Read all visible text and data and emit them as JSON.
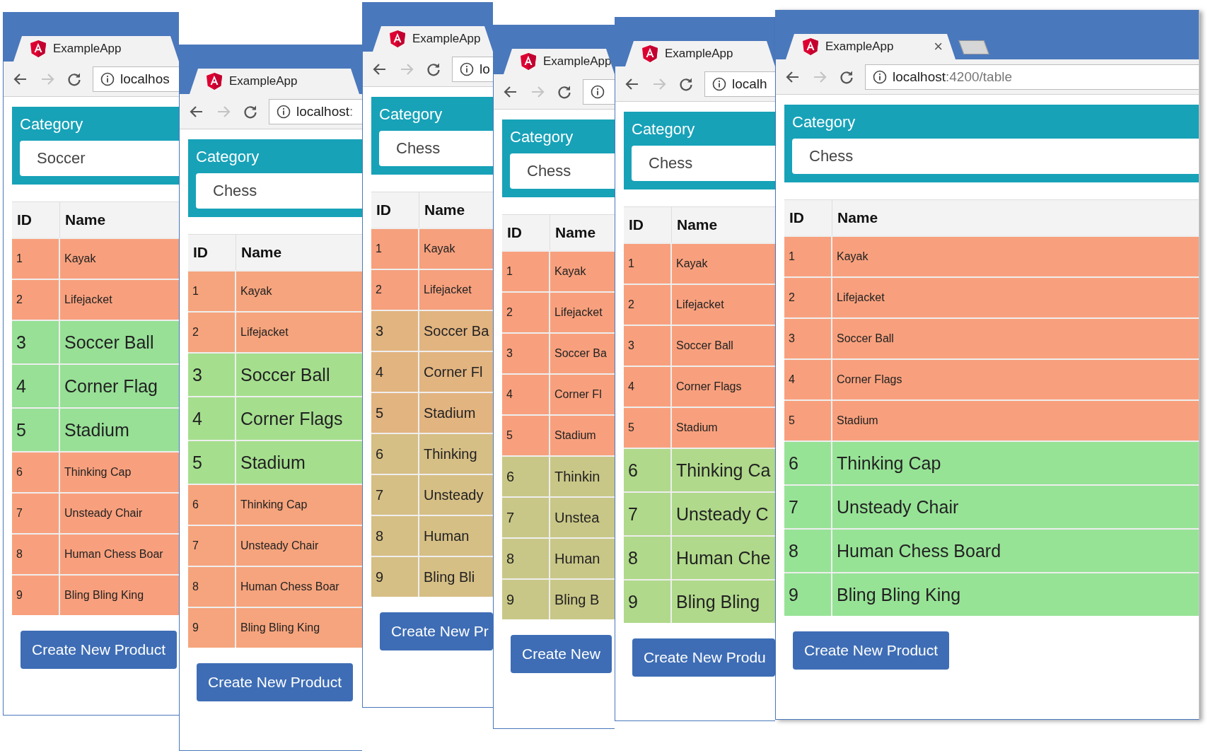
{
  "windows": [
    {
      "tab": {
        "title": "ExampleApp"
      },
      "address": {
        "host": "localhos"
      },
      "category": {
        "label": "Category",
        "value": "Soccer"
      },
      "columns": [
        "ID",
        "Name"
      ],
      "rows": [
        {
          "id": "1",
          "name": "Kayak",
          "kind": "small",
          "color": "#f8a07d"
        },
        {
          "id": "2",
          "name": "Lifejacket",
          "kind": "small",
          "color": "#f8a07d"
        },
        {
          "id": "3",
          "name": "Soccer Ball",
          "kind": "large",
          "color": "#97e096"
        },
        {
          "id": "4",
          "name": "Corner Flag",
          "kind": "large",
          "color": "#97e096"
        },
        {
          "id": "5",
          "name": "Stadium",
          "kind": "large",
          "color": "#97e096"
        },
        {
          "id": "6",
          "name": "Thinking Cap",
          "kind": "small",
          "color": "#f8a07d"
        },
        {
          "id": "7",
          "name": "Unsteady Chair",
          "kind": "small",
          "color": "#f8a07d"
        },
        {
          "id": "8",
          "name": "Human Chess Boar",
          "kind": "small",
          "color": "#f8a07d"
        },
        {
          "id": "9",
          "name": "Bling Bling King",
          "kind": "small",
          "color": "#f8a07d"
        }
      ],
      "button": "Create New Product"
    },
    {
      "tab": {
        "title": "ExampleApp"
      },
      "address": {
        "host": "localhost",
        "path": ":"
      },
      "category": {
        "label": "Category",
        "value": "Chess"
      },
      "columns": [
        "ID",
        "Name"
      ],
      "rows": [
        {
          "id": "1",
          "name": "Kayak",
          "kind": "small",
          "color": "#f6a47d"
        },
        {
          "id": "2",
          "name": "Lifejacket",
          "kind": "small",
          "color": "#f6a47d"
        },
        {
          "id": "3",
          "name": "Soccer Ball",
          "kind": "large",
          "color": "#a5df8e"
        },
        {
          "id": "4",
          "name": "Corner Flags",
          "kind": "large",
          "color": "#a5df8e"
        },
        {
          "id": "5",
          "name": "Stadium",
          "kind": "large",
          "color": "#a5df8e"
        },
        {
          "id": "6",
          "name": "Thinking Cap",
          "kind": "small",
          "color": "#f6a47d"
        },
        {
          "id": "7",
          "name": "Unsteady Chair",
          "kind": "small",
          "color": "#f6a47d"
        },
        {
          "id": "8",
          "name": "Human Chess Boar",
          "kind": "small",
          "color": "#f6a47d"
        },
        {
          "id": "9",
          "name": "Bling Bling King",
          "kind": "small",
          "color": "#f6a47d"
        }
      ],
      "button": "Create New Product"
    },
    {
      "tab": {
        "title": "ExampleApp"
      },
      "address": {
        "host": "lo"
      },
      "category": {
        "label": "Category",
        "value": "Chess"
      },
      "columns": [
        "ID",
        "Name"
      ],
      "rows": [
        {
          "id": "1",
          "name": "Kayak",
          "kind": "small",
          "color": "#f6a07d"
        },
        {
          "id": "2",
          "name": "Lifejacket",
          "kind": "small",
          "color": "#f6a07d"
        },
        {
          "id": "3",
          "name": "Soccer Ba",
          "kind": "medium",
          "color": "#e2b480"
        },
        {
          "id": "4",
          "name": "Corner Fl",
          "kind": "medium",
          "color": "#e2b480"
        },
        {
          "id": "5",
          "name": "Stadium",
          "kind": "medium",
          "color": "#e2b480"
        },
        {
          "id": "6",
          "name": "Thinking",
          "kind": "medium",
          "color": "#d6bf85"
        },
        {
          "id": "7",
          "name": "Unsteady",
          "kind": "medium",
          "color": "#d6bf85"
        },
        {
          "id": "8",
          "name": "Human",
          "kind": "medium",
          "color": "#d6bf85"
        },
        {
          "id": "9",
          "name": "Bling Bli",
          "kind": "medium",
          "color": "#d6bf85"
        }
      ],
      "button": "Create New Pr"
    },
    {
      "tab": {
        "title": "ExampleApp"
      },
      "category": {
        "label": "Category",
        "value": "Chess"
      },
      "columns": [
        "ID",
        "Name"
      ],
      "rows": [
        {
          "id": "1",
          "name": "Kayak",
          "kind": "small",
          "color": "#f8a07d"
        },
        {
          "id": "2",
          "name": "Lifejacket",
          "kind": "small",
          "color": "#f8a07d"
        },
        {
          "id": "3",
          "name": "Soccer Ba",
          "kind": "small",
          "color": "#f8a07d"
        },
        {
          "id": "4",
          "name": "Corner Fl",
          "kind": "small",
          "color": "#f8a07d"
        },
        {
          "id": "5",
          "name": "Stadium",
          "kind": "small",
          "color": "#f8a07d"
        },
        {
          "id": "6",
          "name": "Thinkin",
          "kind": "medium",
          "color": "#c9c787"
        },
        {
          "id": "7",
          "name": "Unstea",
          "kind": "medium",
          "color": "#c9c787"
        },
        {
          "id": "8",
          "name": "Human",
          "kind": "medium",
          "color": "#c9c787"
        },
        {
          "id": "9",
          "name": "Bling B",
          "kind": "medium",
          "color": "#c9c787"
        }
      ],
      "button": "Create New"
    },
    {
      "tab": {
        "title": "ExampleApp"
      },
      "address": {
        "host": "localh"
      },
      "category": {
        "label": "Category",
        "value": "Chess"
      },
      "columns": [
        "ID",
        "Name"
      ],
      "rows": [
        {
          "id": "1",
          "name": "Kayak",
          "kind": "small",
          "color": "#f8a07d"
        },
        {
          "id": "2",
          "name": "Lifejacket",
          "kind": "small",
          "color": "#f8a07d"
        },
        {
          "id": "3",
          "name": "Soccer Ball",
          "kind": "small",
          "color": "#f8a07d"
        },
        {
          "id": "4",
          "name": "Corner Flags",
          "kind": "small",
          "color": "#f8a07d"
        },
        {
          "id": "5",
          "name": "Stadium",
          "kind": "small",
          "color": "#f8a07d"
        },
        {
          "id": "6",
          "name": "Thinking Ca",
          "kind": "large",
          "color": "#b0d98b"
        },
        {
          "id": "7",
          "name": "Unsteady C",
          "kind": "large",
          "color": "#b0d98b"
        },
        {
          "id": "8",
          "name": "Human Che",
          "kind": "large",
          "color": "#b0d98b"
        },
        {
          "id": "9",
          "name": "Bling Bling",
          "kind": "large",
          "color": "#b0d98b"
        }
      ],
      "button": "Create New Produ"
    },
    {
      "tab": {
        "title": "ExampleApp",
        "close": "×"
      },
      "new_tab_button": true,
      "address": {
        "host": "localhost",
        "path": ":4200/table"
      },
      "category": {
        "label": "Category",
        "value": "Chess"
      },
      "columns": [
        "ID",
        "Name"
      ],
      "rows": [
        {
          "id": "1",
          "name": "Kayak",
          "kind": "small",
          "color": "#f8a07d"
        },
        {
          "id": "2",
          "name": "Lifejacket",
          "kind": "small",
          "color": "#f8a07d"
        },
        {
          "id": "3",
          "name": "Soccer Ball",
          "kind": "small",
          "color": "#f8a07d"
        },
        {
          "id": "4",
          "name": "Corner Flags",
          "kind": "small",
          "color": "#f8a07d"
        },
        {
          "id": "5",
          "name": "Stadium",
          "kind": "small",
          "color": "#f8a07d"
        },
        {
          "id": "6",
          "name": "Thinking Cap",
          "kind": "large",
          "color": "#97e396"
        },
        {
          "id": "7",
          "name": "Unsteady Chair",
          "kind": "large",
          "color": "#97e396"
        },
        {
          "id": "8",
          "name": "Human Chess Board",
          "kind": "large",
          "color": "#97e396"
        },
        {
          "id": "9",
          "name": "Bling Bling King",
          "kind": "large",
          "color": "#97e396"
        }
      ],
      "button": "Create New Product"
    }
  ]
}
